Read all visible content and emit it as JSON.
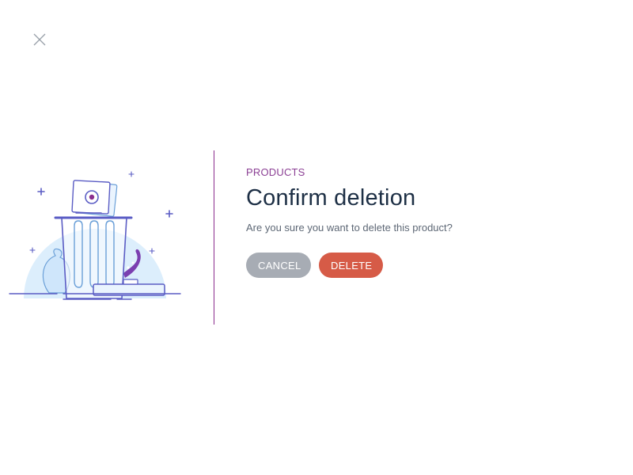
{
  "dialog": {
    "overline": "PRODUCTS",
    "title": "Confirm deletion",
    "message": "Are you sure you want to delete this product?",
    "cancel_label": "CANCEL",
    "delete_label": "DELETE"
  },
  "icons": {
    "close": "close-icon",
    "illustration": "trash-can-illustration"
  },
  "colors": {
    "accent": "#8b2d8e",
    "title": "#1d2f45",
    "cancel_button": "#a7acb4",
    "delete_button": "#d65b47",
    "illustration_line": "#5a5cc4",
    "illustration_fill": "#dceefc"
  }
}
